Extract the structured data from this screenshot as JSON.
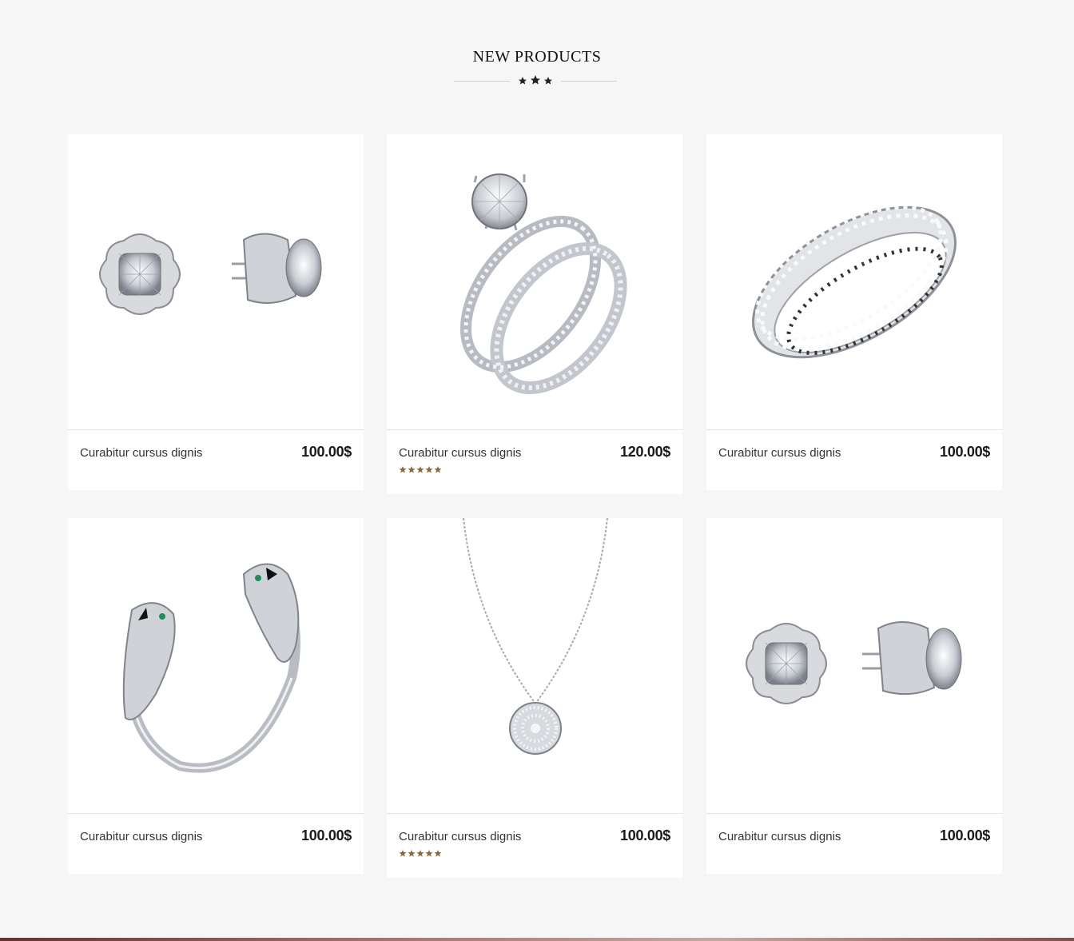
{
  "section": {
    "title": "NEW PRODUCTS"
  },
  "colors": {
    "background": "#f6f6f6",
    "card": "#ffffff",
    "rating_star": "#8b6a3a",
    "text": "#222222"
  },
  "products": [
    {
      "name": "Curabitur cursus dignis",
      "price": "100.00$",
      "image": "stud-earrings",
      "rating": null
    },
    {
      "name": "Curabitur cursus dignis",
      "price": "120.00$",
      "image": "diamond-ring-set",
      "rating": 5
    },
    {
      "name": "Curabitur cursus dignis",
      "price": "100.00$",
      "image": "eternity-band",
      "rating": null
    },
    {
      "name": "Curabitur cursus dignis",
      "price": "100.00$",
      "image": "bird-cuff-bracelet",
      "rating": null
    },
    {
      "name": "Curabitur cursus dignis",
      "price": "100.00$",
      "image": "pave-disc-necklace",
      "rating": 5
    },
    {
      "name": "Curabitur cursus dignis",
      "price": "100.00$",
      "image": "stud-earrings",
      "rating": null
    }
  ]
}
